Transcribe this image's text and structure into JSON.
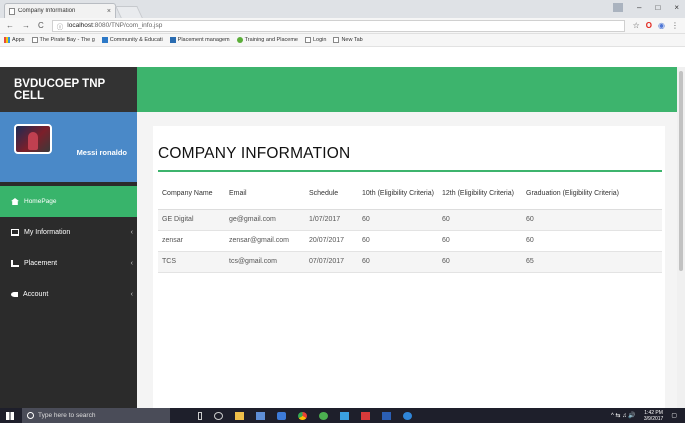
{
  "browser": {
    "tab_title": "Company Information",
    "tab_close": "×",
    "url_host": "localhost",
    "url_rest": ":8080/TNP/com_info.jsp",
    "window_controls": [
      "–",
      "□",
      "×"
    ],
    "nav": {
      "back": "←",
      "forward": "→",
      "reload": "C",
      "info": "ⓘ",
      "star": "☆"
    },
    "bookmarks": [
      {
        "label": "Apps",
        "icon": "apps"
      },
      {
        "label": "The Pirate Bay - The g",
        "icon": "doc"
      },
      {
        "label": "Community & Educati",
        "icon": "blue"
      },
      {
        "label": "Placement managem",
        "icon": "li"
      },
      {
        "label": "Training and Placeme",
        "icon": "green"
      },
      {
        "label": "Login",
        "icon": "doc"
      },
      {
        "label": "New Tab",
        "icon": "doc"
      }
    ]
  },
  "sidebar": {
    "brand": "BVDUCOEP TNP CELL",
    "user_name": "Messi ronaldo",
    "items": [
      {
        "label": "HomePage",
        "icon": "home-icon",
        "active": true,
        "chevron": ""
      },
      {
        "label": "My Information",
        "icon": "monitor-icon",
        "active": false,
        "chevron": "‹"
      },
      {
        "label": "Placement",
        "icon": "sitemap-icon",
        "active": false,
        "chevron": "‹"
      },
      {
        "label": "Account",
        "icon": "key-icon",
        "active": false,
        "chevron": "‹"
      }
    ]
  },
  "main": {
    "title": "COMPANY INFORMATION",
    "table": {
      "headers": [
        "Company Name",
        "Email",
        "Schedule",
        "10th (Eligibility Criteria)",
        "12th (Eligibility Criteria)",
        "Graduation (Eligibility Criteria)"
      ],
      "rows": [
        [
          "GE Digital",
          "ge@gmail.com",
          "1/07/2017",
          "60",
          "60",
          "60"
        ],
        [
          "zensar",
          "zensar@gmail.com",
          "20/07/2017",
          "60",
          "60",
          "60"
        ],
        [
          "TCS",
          "tcs@gmail.com",
          "07/07/2017",
          "60",
          "60",
          "65"
        ]
      ]
    }
  },
  "taskbar": {
    "search_placeholder": "Type here to search",
    "time": "1:42 PM",
    "date": "3/9/2017",
    "tray_symbols": "^ ⇆ ♫ 🔊"
  },
  "colors": {
    "accent_green": "#3db46d",
    "sidebar_dark": "#2b2b2b",
    "profile_blue": "#4a89c8"
  }
}
